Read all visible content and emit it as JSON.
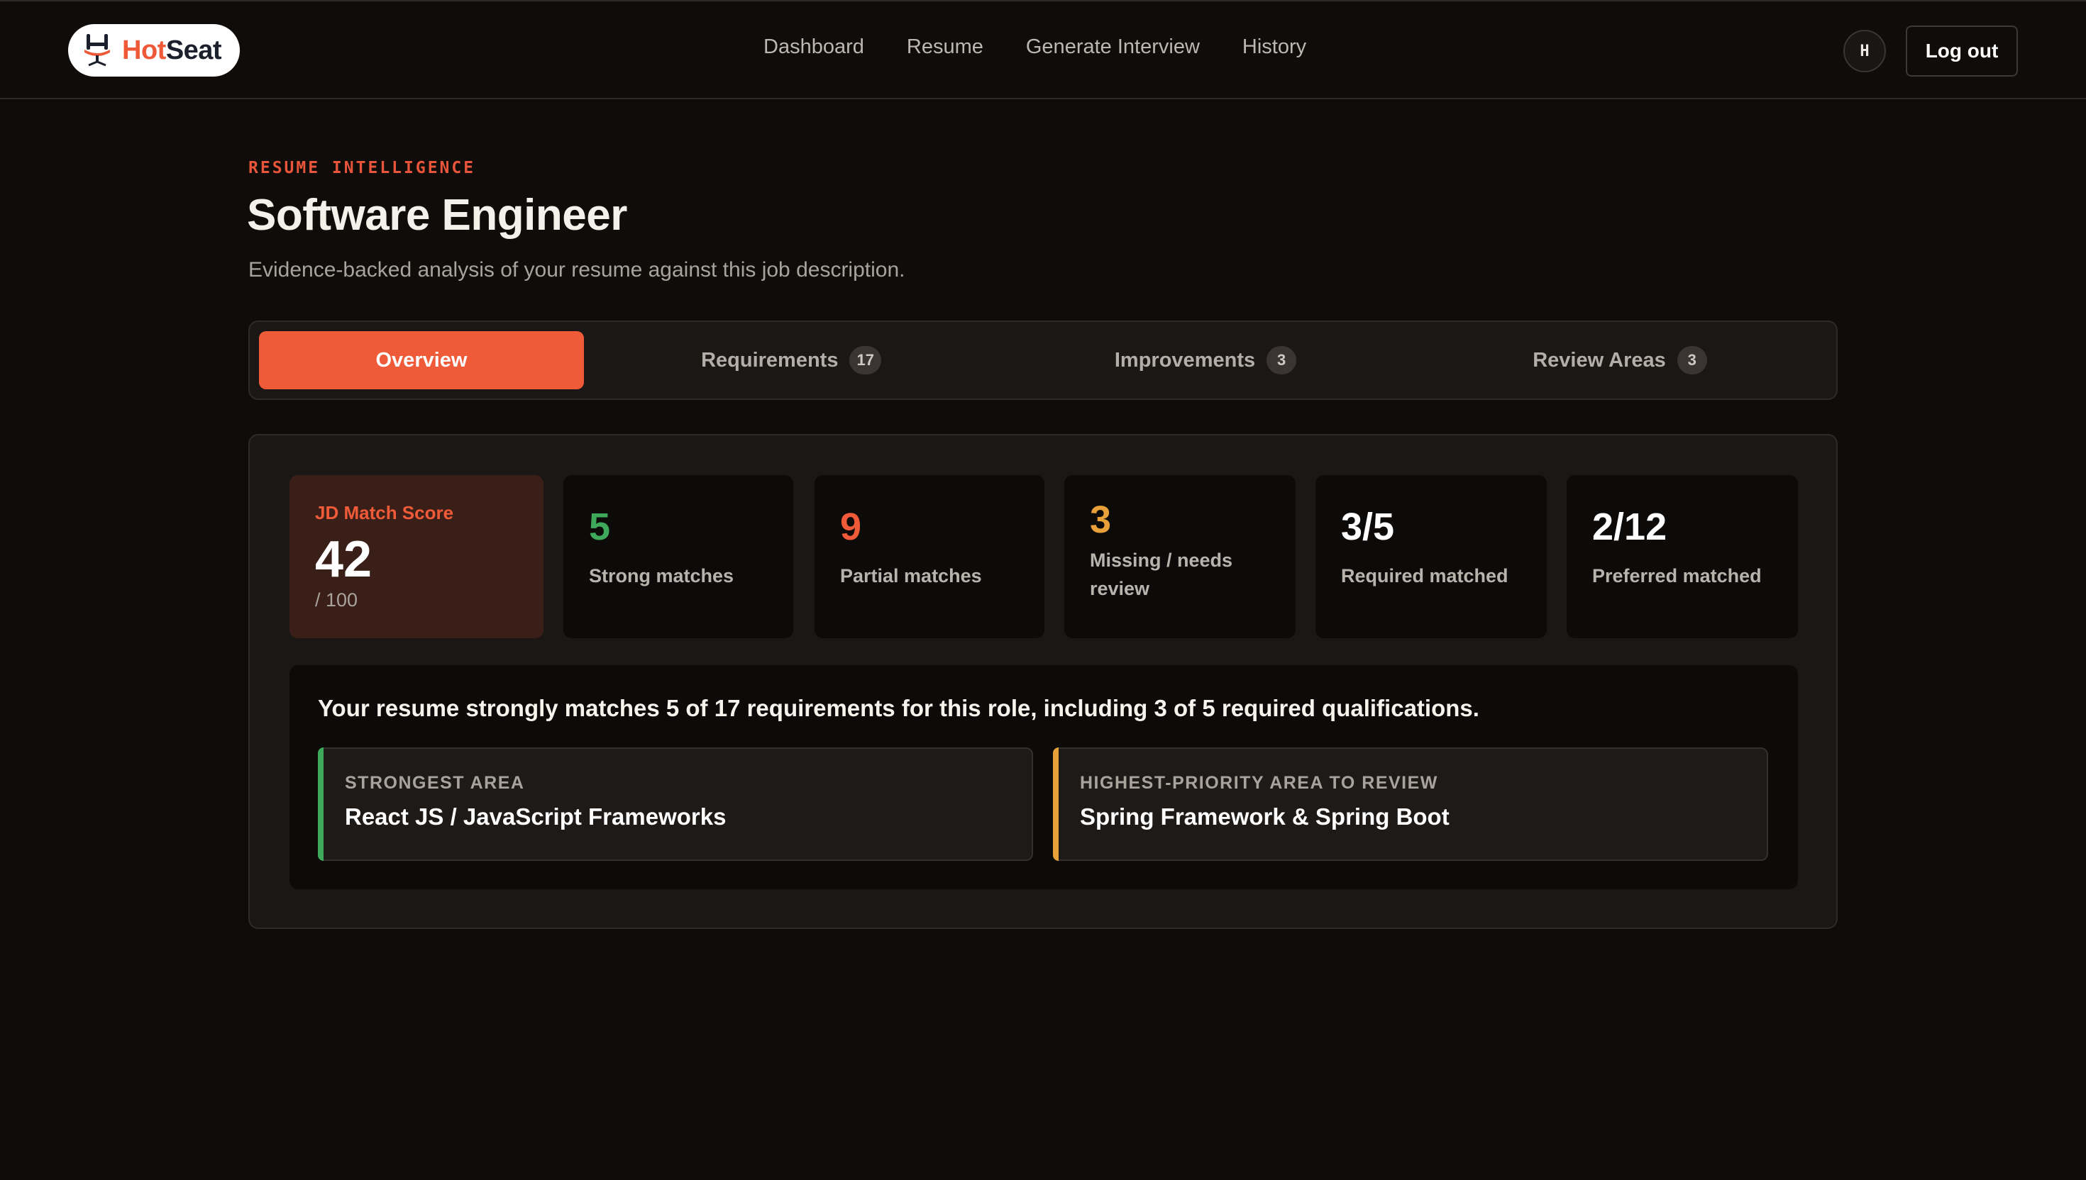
{
  "brand": {
    "name_part1": "Hot",
    "name_part2": "Seat",
    "accent_color": "#ee5a38"
  },
  "nav": {
    "items": [
      {
        "label": "Dashboard"
      },
      {
        "label": "Resume"
      },
      {
        "label": "Generate Interview"
      },
      {
        "label": "History"
      }
    ],
    "avatar_initial": "H",
    "logout_label": "Log out"
  },
  "header": {
    "eyebrow": "RESUME INTELLIGENCE",
    "title": "Software Engineer",
    "subtitle": "Evidence-backed analysis of your resume against this job description."
  },
  "tabs": [
    {
      "label": "Overview",
      "active": true,
      "count": ""
    },
    {
      "label": "Requirements",
      "active": false,
      "count": "17"
    },
    {
      "label": "Improvements",
      "active": false,
      "count": "3"
    },
    {
      "label": "Review Areas",
      "active": false,
      "count": "3"
    }
  ],
  "score": {
    "label": "JD Match Score",
    "value": "42",
    "max": "/ 100"
  },
  "stats": [
    {
      "value": "5",
      "caption": "Strong matches",
      "color": "#3fa95b"
    },
    {
      "value": "9",
      "caption": "Partial matches",
      "color": "#ef5a38"
    },
    {
      "value": "3",
      "caption": "Missing / needs review",
      "color": "#e8a13a"
    },
    {
      "value": "3/5",
      "caption": "Required matched",
      "color": "#ffffff"
    },
    {
      "value": "2/12",
      "caption": "Preferred matched",
      "color": "#ffffff"
    }
  ],
  "summary": {
    "text": "Your resume strongly matches 5 of 17 requirements for this role, including 3 of 5 required qualifications.",
    "strongest": {
      "kicker": "STRONGEST AREA",
      "value": "React JS / JavaScript Frameworks",
      "accent": "#3fa95b"
    },
    "priority": {
      "kicker": "HIGHEST-PRIORITY AREA TO REVIEW",
      "value": "Spring Framework & Spring Boot",
      "accent": "#e8a13a"
    }
  }
}
